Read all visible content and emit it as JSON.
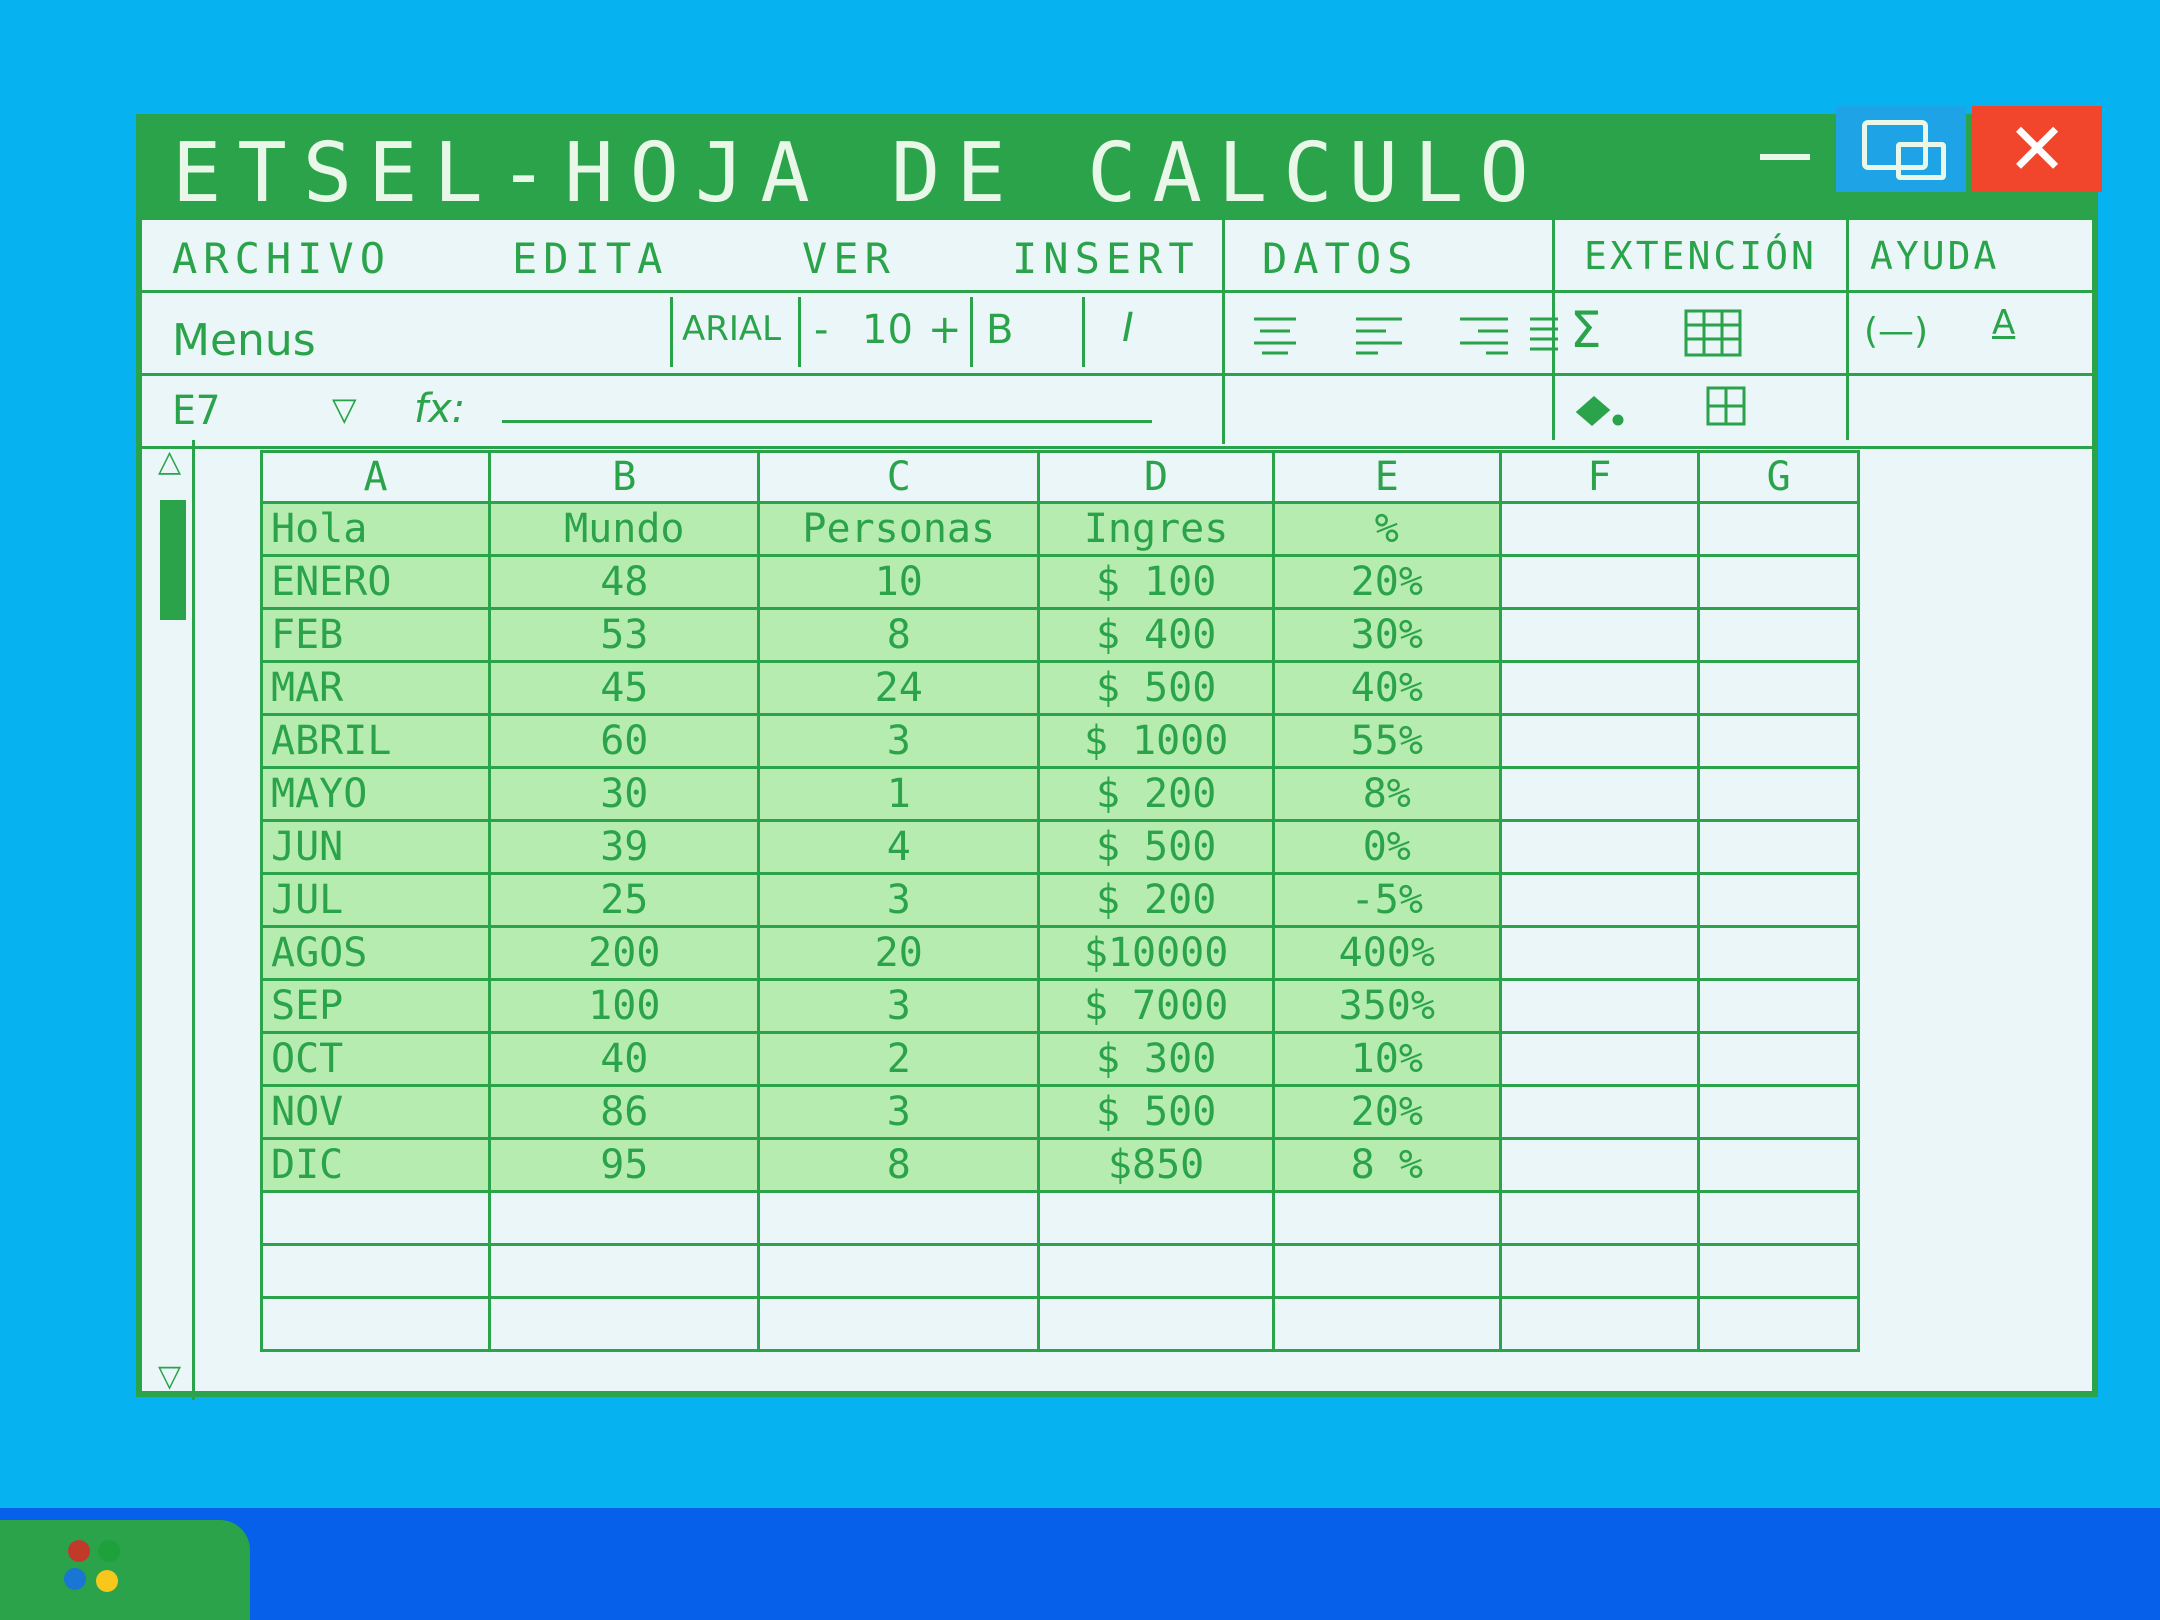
{
  "window": {
    "title": "ETSEL-HOJA DE CALCULO",
    "minimize_label": "—",
    "close_label": "✕"
  },
  "menu": [
    "ARCHIVO",
    "EDITA",
    "VER",
    "INSERT",
    "DATOS",
    "EXTENCIÓN",
    "AYUDA"
  ],
  "toolbar": {
    "menus_label": "Menus",
    "font": "ARIAL",
    "font_size_decrease": "-",
    "font_size": "10",
    "font_size_increase": "+",
    "bold": "B",
    "italic": "I",
    "sum": "Σ",
    "undo_redo": "(—)",
    "text_color": "A"
  },
  "formula_bar": {
    "cell_ref": "E7",
    "dropdown": "▽",
    "fx": "fx:",
    "value": ""
  },
  "sheet": {
    "columns": [
      "A",
      "B",
      "C",
      "D",
      "E",
      "F",
      "G"
    ],
    "rows": [
      [
        "Hola",
        "Mundo",
        "Personas",
        "Ingres",
        "%"
      ],
      [
        "ENERO",
        "48",
        "10",
        "$ 100",
        "20%"
      ],
      [
        "FEB",
        "53",
        "8",
        "$ 400",
        "30%"
      ],
      [
        "MAR",
        "45",
        "24",
        "$ 500",
        "40%"
      ],
      [
        "ABRIL",
        "60",
        "3",
        "$ 1000",
        "55%"
      ],
      [
        "MAYO",
        "30",
        "1",
        "$ 200",
        "8%"
      ],
      [
        "JUN",
        "39",
        "4",
        "$ 500",
        "0%"
      ],
      [
        "JUL",
        "25",
        "3",
        "$ 200",
        "-5%"
      ],
      [
        "AGOS",
        "200",
        "20",
        "$10000",
        "400%"
      ],
      [
        "SEP",
        "100",
        "3",
        "$ 7000",
        "350%"
      ],
      [
        "OCT",
        "40",
        "2",
        "$ 300",
        "10%"
      ],
      [
        "NOV",
        "86",
        "3",
        "$ 500",
        "20%"
      ],
      [
        "DIC",
        "95",
        "8",
        "$850",
        "8 %"
      ]
    ]
  },
  "colors": {
    "desktop": "#06b3f0",
    "accent": "#2aa34a",
    "cell_fill": "#b6ecb0",
    "close": "#f1462b",
    "taskbar": "#0760ea"
  }
}
